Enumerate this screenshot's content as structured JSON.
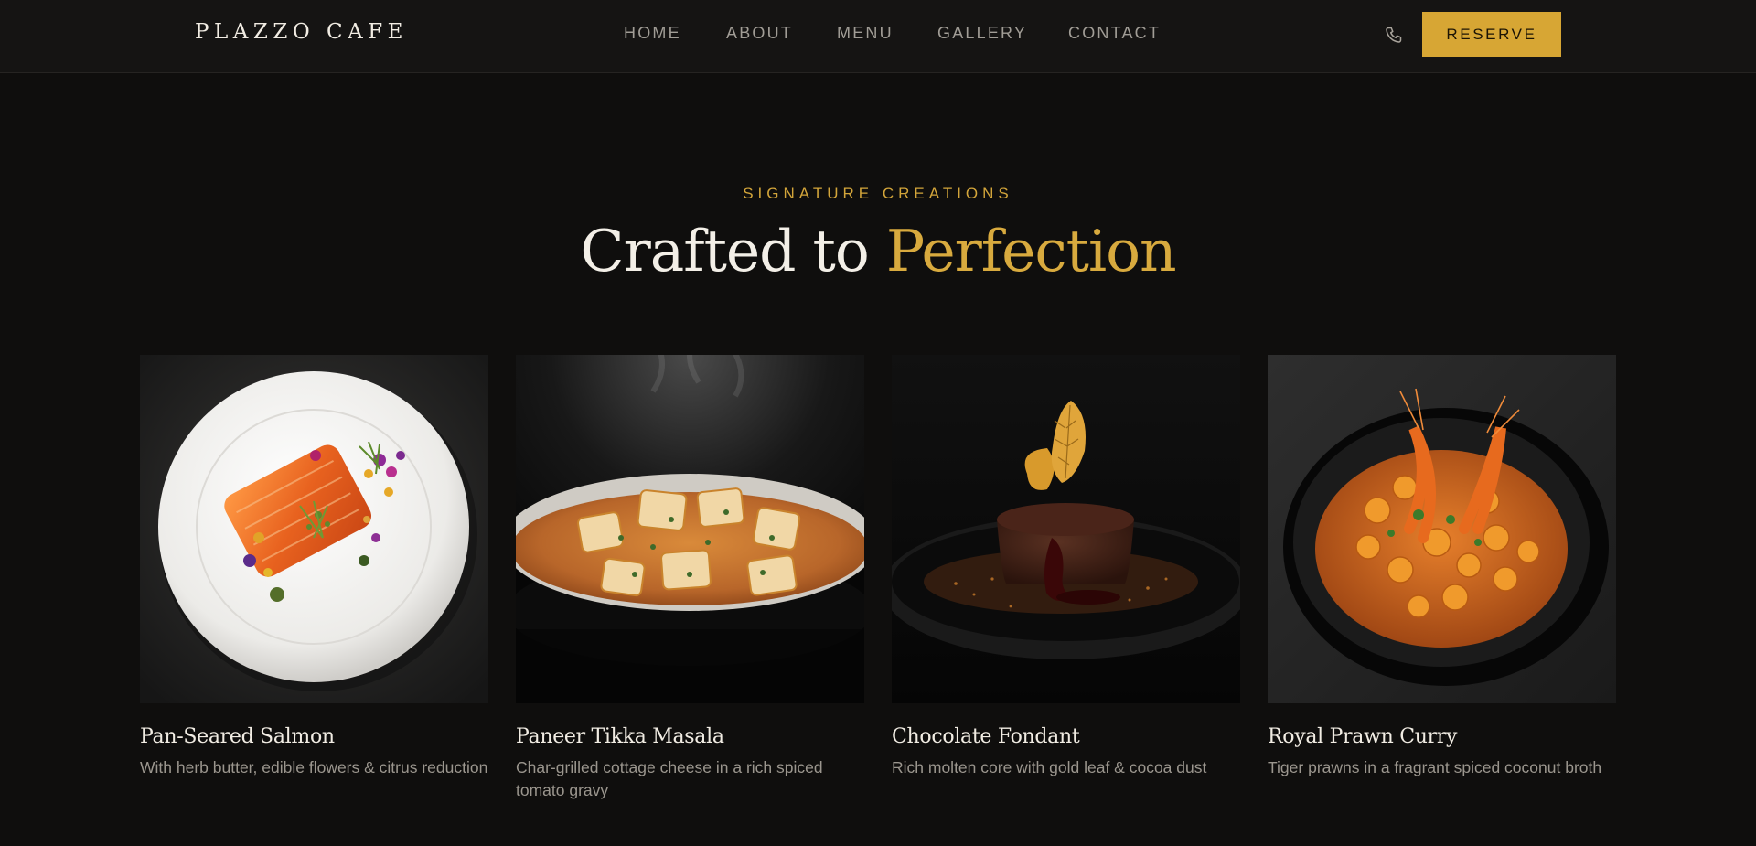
{
  "brand": {
    "name": "PLAZZO CAFE"
  },
  "nav": {
    "items": [
      {
        "label": "HOME"
      },
      {
        "label": "ABOUT"
      },
      {
        "label": "MENU"
      },
      {
        "label": "GALLERY"
      },
      {
        "label": "CONTACT"
      }
    ],
    "phone_icon": "phone-icon",
    "reserve_label": "RESERVE"
  },
  "section": {
    "eyebrow": "SIGNATURE CREATIONS",
    "title_prefix": "Crafted to ",
    "title_accent": "Perfection"
  },
  "dishes": [
    {
      "name": "Pan-Seared Salmon",
      "description": "With herb butter, edible flowers & citrus reduction"
    },
    {
      "name": "Paneer Tikka Masala",
      "description": "Char-grilled cottage cheese in a rich spiced tomato gravy"
    },
    {
      "name": "Chocolate Fondant",
      "description": "Rich molten core with gold leaf & cocoa dust"
    },
    {
      "name": "Royal Prawn Curry",
      "description": "Tiger prawns in a fragrant spiced coconut broth"
    }
  ],
  "colors": {
    "accent": "#d7a634",
    "background": "#0f0e0d",
    "header": "#151413"
  }
}
